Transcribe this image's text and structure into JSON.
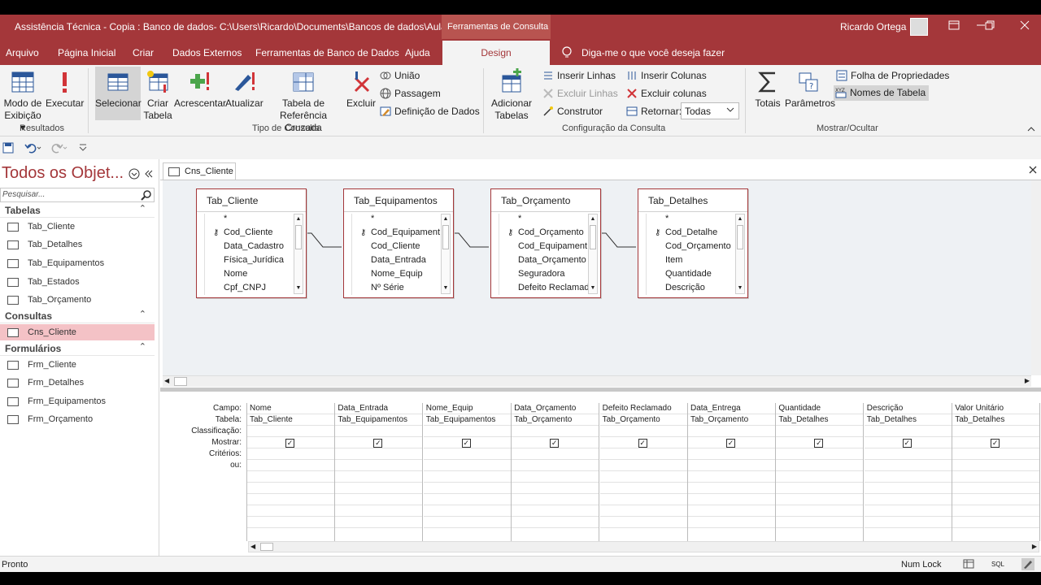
{
  "window": {
    "title": "Assistência Técnica - Copia : Banco de dados- C:\\Users\\Ricardo\\Documents\\Bancos de dados\\Aulas\\...",
    "context_tab": "Ferramentas de Consulta",
    "user": "Ricardo Ortega"
  },
  "menu": {
    "items": [
      "Arquivo",
      "Página Inicial",
      "Criar",
      "Dados Externos",
      "Ferramentas de Banco de Dados",
      "Ajuda"
    ],
    "design": "Design",
    "tellme": "Diga-me o que você deseja fazer"
  },
  "ribbon": {
    "results": {
      "view_label_1": "Modo de",
      "view_label_2": "Exibição",
      "run": "Executar",
      "group": "Resultados"
    },
    "query_type": {
      "select": "Selecionar",
      "make_table_1": "Criar",
      "make_table_2": "Tabela",
      "append": "Acrescentar",
      "update": "Atualizar",
      "crosstab_1": "Tabela de",
      "crosstab_2": "Referência Cruzada",
      "delete": "Excluir",
      "union": "União",
      "passthrough": "Passagem",
      "data_def": "Definição de Dados",
      "group": "Tipo de Consulta"
    },
    "setup": {
      "show_table_1": "Adicionar",
      "show_table_2": "Tabelas",
      "insert_rows": "Inserir Linhas",
      "delete_rows": "Excluir Linhas",
      "builder": "Construtor",
      "insert_cols": "Inserir Colunas",
      "delete_cols": "Excluir colunas",
      "return_label": "Retornar:",
      "return_value": "Todas",
      "group": "Configuração da Consulta"
    },
    "show_hide": {
      "totals": "Totais",
      "params": "Parâmetros",
      "prop_sheet": "Folha de Propriedades",
      "table_names": "Nomes de Tabela",
      "group": "Mostrar/Ocultar"
    }
  },
  "nav": {
    "header": "Todos os Objet...",
    "search_placeholder": "Pesquisar...",
    "sections": [
      {
        "title": "Tabelas",
        "items": [
          "Tab_Cliente",
          "Tab_Detalhes",
          "Tab_Equipamentos",
          "Tab_Estados",
          "Tab_Orçamento"
        ]
      },
      {
        "title": "Consultas",
        "items": [
          "Cns_Cliente"
        ]
      },
      {
        "title": "Formulários",
        "items": [
          "Frm_Cliente",
          "Frm_Detalhes",
          "Frm_Equipamentos",
          "Frm_Orçamento"
        ]
      }
    ]
  },
  "document": {
    "tab": "Cns_Cliente",
    "tables": [
      {
        "name": "Tab_Cliente",
        "fields": [
          "*",
          "Cod_Cliente",
          "Data_Cadastro",
          "Física_Jurídica",
          "Nome",
          "Cpf_CNPJ"
        ],
        "key": 1
      },
      {
        "name": "Tab_Equipamentos",
        "fields": [
          "*",
          "Cod_Equipament",
          "Cod_Cliente",
          "Data_Entrada",
          "Nome_Equip",
          "Nº Série"
        ],
        "key": 1
      },
      {
        "name": "Tab_Orçamento",
        "fields": [
          "*",
          "Cod_Orçamento",
          "Cod_Equipament",
          "Data_Orçamento",
          "Seguradora",
          "Defeito Reclamad"
        ],
        "key": 1
      },
      {
        "name": "Tab_Detalhes",
        "fields": [
          "*",
          "Cod_Detalhe",
          "Cod_Orçamento",
          "Item",
          "Quantidade",
          "Descrição"
        ],
        "key": 1
      }
    ],
    "grid_labels": [
      "Campo:",
      "Tabela:",
      "Classificação:",
      "Mostrar:",
      "Critérios:",
      "ou:"
    ],
    "columns": [
      {
        "field": "Nome",
        "table": "Tab_Cliente",
        "show": true
      },
      {
        "field": "Data_Entrada",
        "table": "Tab_Equipamentos",
        "show": true
      },
      {
        "field": "Nome_Equip",
        "table": "Tab_Equipamentos",
        "show": true
      },
      {
        "field": "Data_Orçamento",
        "table": "Tab_Orçamento",
        "show": true
      },
      {
        "field": "Defeito Reclamado",
        "table": "Tab_Orçamento",
        "show": true
      },
      {
        "field": "Data_Entrega",
        "table": "Tab_Orçamento",
        "show": true
      },
      {
        "field": "Quantidade",
        "table": "Tab_Detalhes",
        "show": true
      },
      {
        "field": "Descrição",
        "table": "Tab_Detalhes",
        "show": true
      },
      {
        "field": "Valor Unitário",
        "table": "Tab_Detalhes",
        "show": true
      }
    ]
  },
  "status": {
    "left": "Pronto",
    "right": "Num Lock"
  },
  "colors": {
    "accent": "#a4373a",
    "selected_nav": "#f4c2c6"
  }
}
